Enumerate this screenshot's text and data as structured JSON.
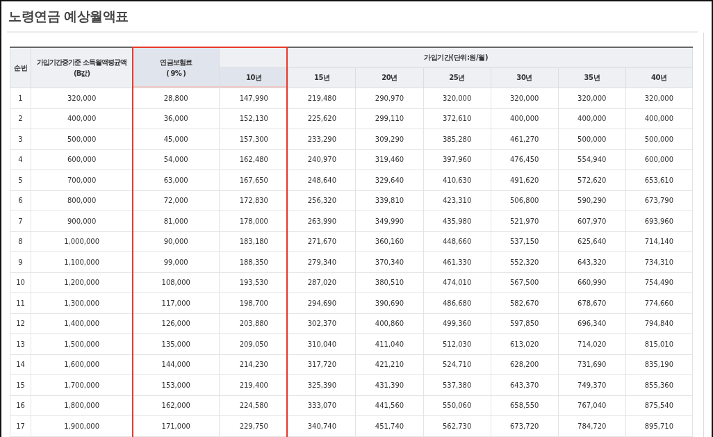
{
  "title": "노령연금 예상월액표",
  "table": {
    "columns": [
      {
        "lines": [
          "순번"
        ],
        "highlighted": false
      },
      {
        "lines": [
          "가입기간중기준 소득월액평균액",
          "(B값)"
        ],
        "highlighted": false
      },
      {
        "lines": [
          "연금보험료",
          "( 9% )"
        ],
        "highlighted": true
      }
    ],
    "group": {
      "label": "가입기간(단위:원/월)",
      "columns": [
        {
          "label": "10년",
          "highlighted": true
        },
        {
          "label": "15년",
          "highlighted": false
        },
        {
          "label": "20년",
          "highlighted": false
        },
        {
          "label": "25년",
          "highlighted": false
        },
        {
          "label": "30년",
          "highlighted": false
        },
        {
          "label": "35년",
          "highlighted": false
        },
        {
          "label": "40년",
          "highlighted": false
        }
      ]
    },
    "rows": [
      [
        "1",
        "320,000",
        "28,800",
        "147,990",
        "219,480",
        "290,970",
        "320,000",
        "320,000",
        "320,000",
        "320,000"
      ],
      [
        "2",
        "400,000",
        "36,000",
        "152,130",
        "225,620",
        "299,110",
        "372,610",
        "400,000",
        "400,000",
        "400,000"
      ],
      [
        "3",
        "500,000",
        "45,000",
        "157,300",
        "233,290",
        "309,290",
        "385,280",
        "461,270",
        "500,000",
        "500,000"
      ],
      [
        "4",
        "600,000",
        "54,000",
        "162,480",
        "240,970",
        "319,460",
        "397,960",
        "476,450",
        "554,940",
        "600,000"
      ],
      [
        "5",
        "700,000",
        "63,000",
        "167,650",
        "248,640",
        "329,640",
        "410,630",
        "491,620",
        "572,620",
        "653,610"
      ],
      [
        "6",
        "800,000",
        "72,000",
        "172,830",
        "256,320",
        "339,810",
        "423,310",
        "506,800",
        "590,290",
        "673,790"
      ],
      [
        "7",
        "900,000",
        "81,000",
        "178,000",
        "263,990",
        "349,990",
        "435,980",
        "521,970",
        "607,970",
        "693,960"
      ],
      [
        "8",
        "1,000,000",
        "90,000",
        "183,180",
        "271,670",
        "360,160",
        "448,660",
        "537,150",
        "625,640",
        "714,140"
      ],
      [
        "9",
        "1,100,000",
        "99,000",
        "188,350",
        "279,340",
        "370,340",
        "461,330",
        "552,320",
        "643,320",
        "734,310"
      ],
      [
        "10",
        "1,200,000",
        "108,000",
        "193,530",
        "287,020",
        "380,510",
        "474,010",
        "567,500",
        "660,990",
        "754,490"
      ],
      [
        "11",
        "1,300,000",
        "117,000",
        "198,700",
        "294,690",
        "390,690",
        "486,680",
        "582,670",
        "678,670",
        "774,660"
      ],
      [
        "12",
        "1,400,000",
        "126,000",
        "203,880",
        "302,370",
        "400,860",
        "499,360",
        "597,850",
        "696,340",
        "794,840"
      ],
      [
        "13",
        "1,500,000",
        "135,000",
        "209,050",
        "310,040",
        "411,040",
        "512,030",
        "613,020",
        "714,020",
        "815,010"
      ],
      [
        "14",
        "1,600,000",
        "144,000",
        "214,230",
        "317,720",
        "421,210",
        "524,710",
        "628,200",
        "731,690",
        "835,190"
      ],
      [
        "15",
        "1,700,000",
        "153,000",
        "219,400",
        "325,390",
        "431,390",
        "537,380",
        "643,370",
        "749,370",
        "855,360"
      ],
      [
        "16",
        "1,800,000",
        "162,000",
        "224,580",
        "333,070",
        "441,560",
        "550,060",
        "658,550",
        "767,040",
        "875,540"
      ],
      [
        "17",
        "1,900,000",
        "171,000",
        "229,750",
        "340,740",
        "451,740",
        "562,730",
        "673,720",
        "784,720",
        "895,710"
      ]
    ]
  }
}
